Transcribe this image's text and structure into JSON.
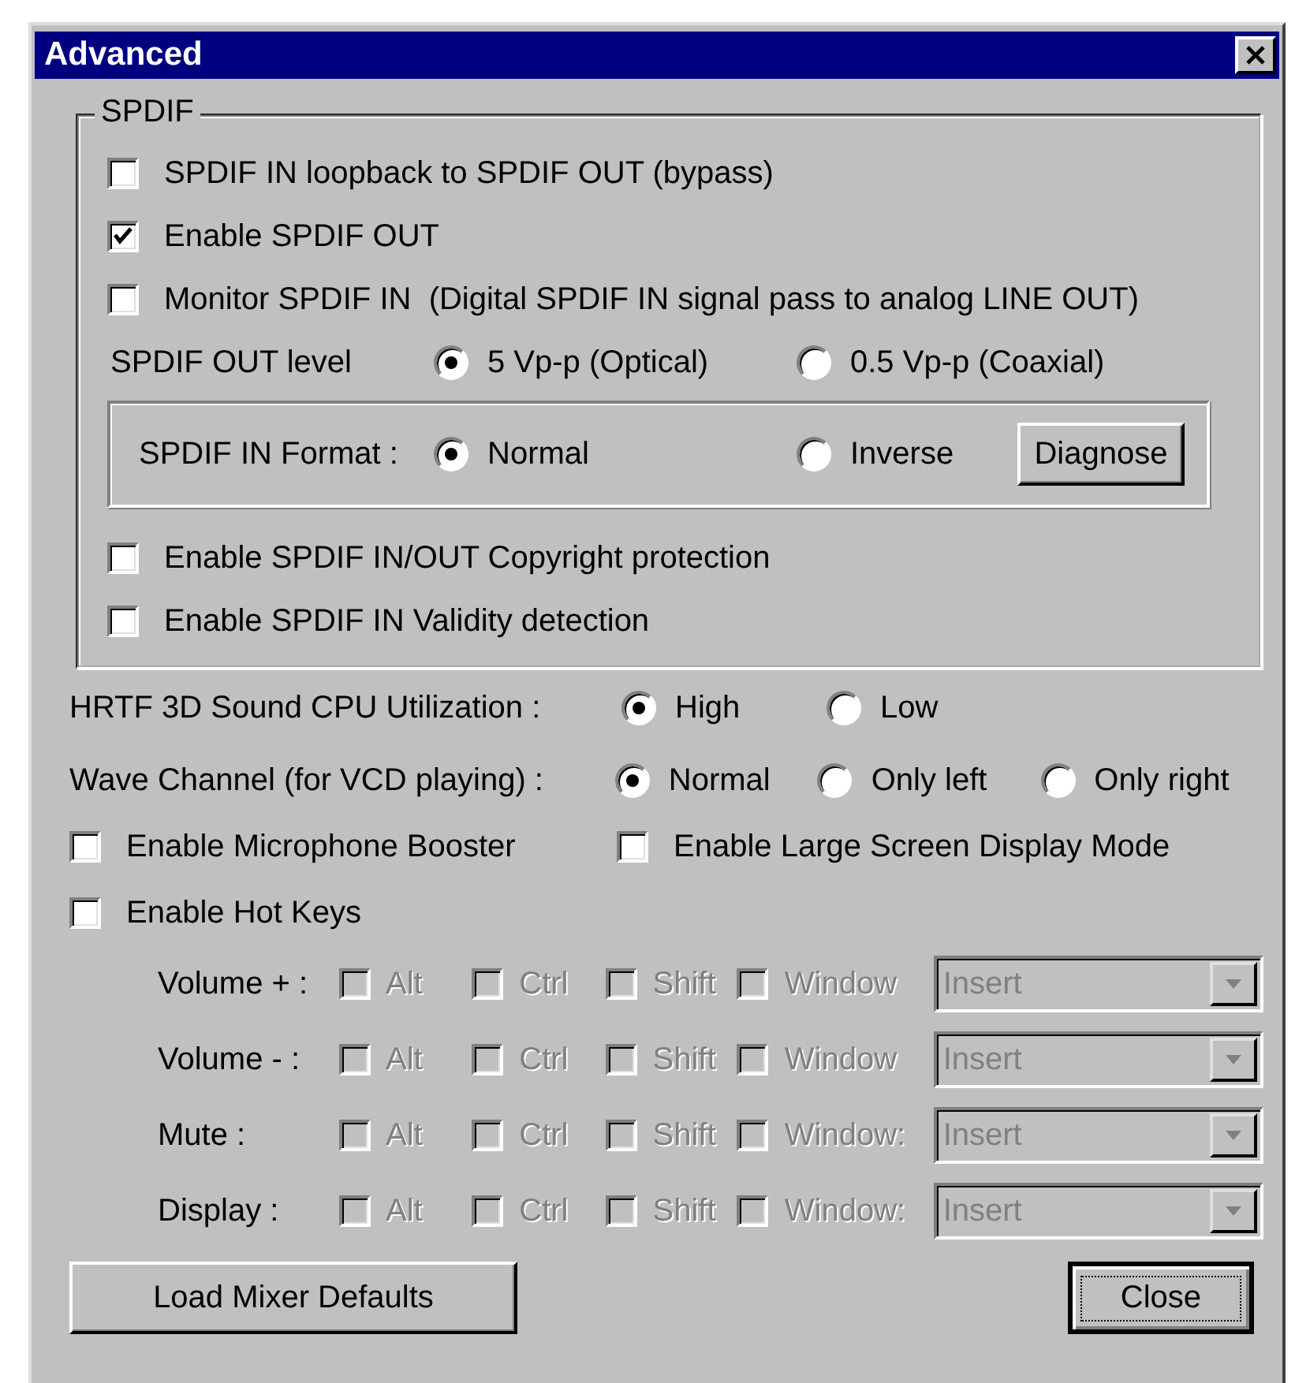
{
  "window": {
    "title": "Advanced"
  },
  "spdif": {
    "title": "SPDIF",
    "options": [
      {
        "label": "SPDIF IN loopback to SPDIF OUT (bypass)",
        "checked": false
      },
      {
        "label": "Enable SPDIF OUT",
        "checked": true
      },
      {
        "label": "Monitor SPDIF IN  (Digital SPDIF IN signal pass to analog LINE OUT)",
        "checked": false
      }
    ],
    "out_level": {
      "label": "SPDIF OUT level",
      "options": [
        {
          "label": "5 Vp-p (Optical)",
          "selected": true
        },
        {
          "label": "0.5 Vp-p (Coaxial)",
          "selected": false
        }
      ]
    },
    "in_format": {
      "label": "SPDIF IN Format :",
      "options": [
        {
          "label": "Normal",
          "selected": true
        },
        {
          "label": "Inverse",
          "selected": false
        }
      ],
      "button": "Diagnose"
    },
    "protection": [
      {
        "label": "Enable SPDIF IN/OUT Copyright protection",
        "checked": false
      },
      {
        "label": "Enable SPDIF IN Validity detection",
        "checked": false
      }
    ]
  },
  "hrtf": {
    "label": "HRTF 3D Sound CPU Utilization :",
    "options": [
      {
        "label": "High",
        "selected": true
      },
      {
        "label": "Low",
        "selected": false
      }
    ]
  },
  "wave_channel": {
    "label": "Wave Channel (for VCD playing) :",
    "options": [
      {
        "label": "Normal",
        "selected": true
      },
      {
        "label": "Only left",
        "selected": false
      },
      {
        "label": "Only right",
        "selected": false
      }
    ]
  },
  "checks": [
    {
      "label": "Enable Microphone Booster",
      "checked": false
    },
    {
      "label": "Enable Large Screen Display Mode",
      "checked": false
    }
  ],
  "hot_keys": {
    "label": "Enable Hot Keys",
    "checked": false,
    "rows": [
      {
        "label": "Volume + :",
        "disabled": true,
        "modifiers": [
          {
            "label": "Alt",
            "checked": false
          },
          {
            "label": "Ctrl",
            "checked": false
          },
          {
            "label": "Shift",
            "checked": false
          },
          {
            "label": "Window",
            "checked": false
          }
        ],
        "key": "Insert"
      },
      {
        "label": "Volume - :",
        "disabled": true,
        "modifiers": [
          {
            "label": "Alt",
            "checked": false
          },
          {
            "label": "Ctrl",
            "checked": false
          },
          {
            "label": "Shift",
            "checked": false
          },
          {
            "label": "Window",
            "checked": false
          }
        ],
        "key": "Insert"
      },
      {
        "label": "Mute :",
        "disabled": true,
        "modifiers": [
          {
            "label": "Alt",
            "checked": false
          },
          {
            "label": "Ctrl",
            "checked": false
          },
          {
            "label": "Shift",
            "checked": false
          },
          {
            "label": "Window:",
            "checked": false
          }
        ],
        "key": "Insert"
      },
      {
        "label": "Display :",
        "disabled": true,
        "modifiers": [
          {
            "label": "Alt",
            "checked": false
          },
          {
            "label": "Ctrl",
            "checked": false
          },
          {
            "label": "Shift",
            "checked": false
          },
          {
            "label": "Window:",
            "checked": false
          }
        ],
        "key": "Insert"
      }
    ]
  },
  "buttons": [
    {
      "label": "Load Mixer Defaults",
      "focused": false
    },
    {
      "label": "Close",
      "focused": true
    }
  ]
}
